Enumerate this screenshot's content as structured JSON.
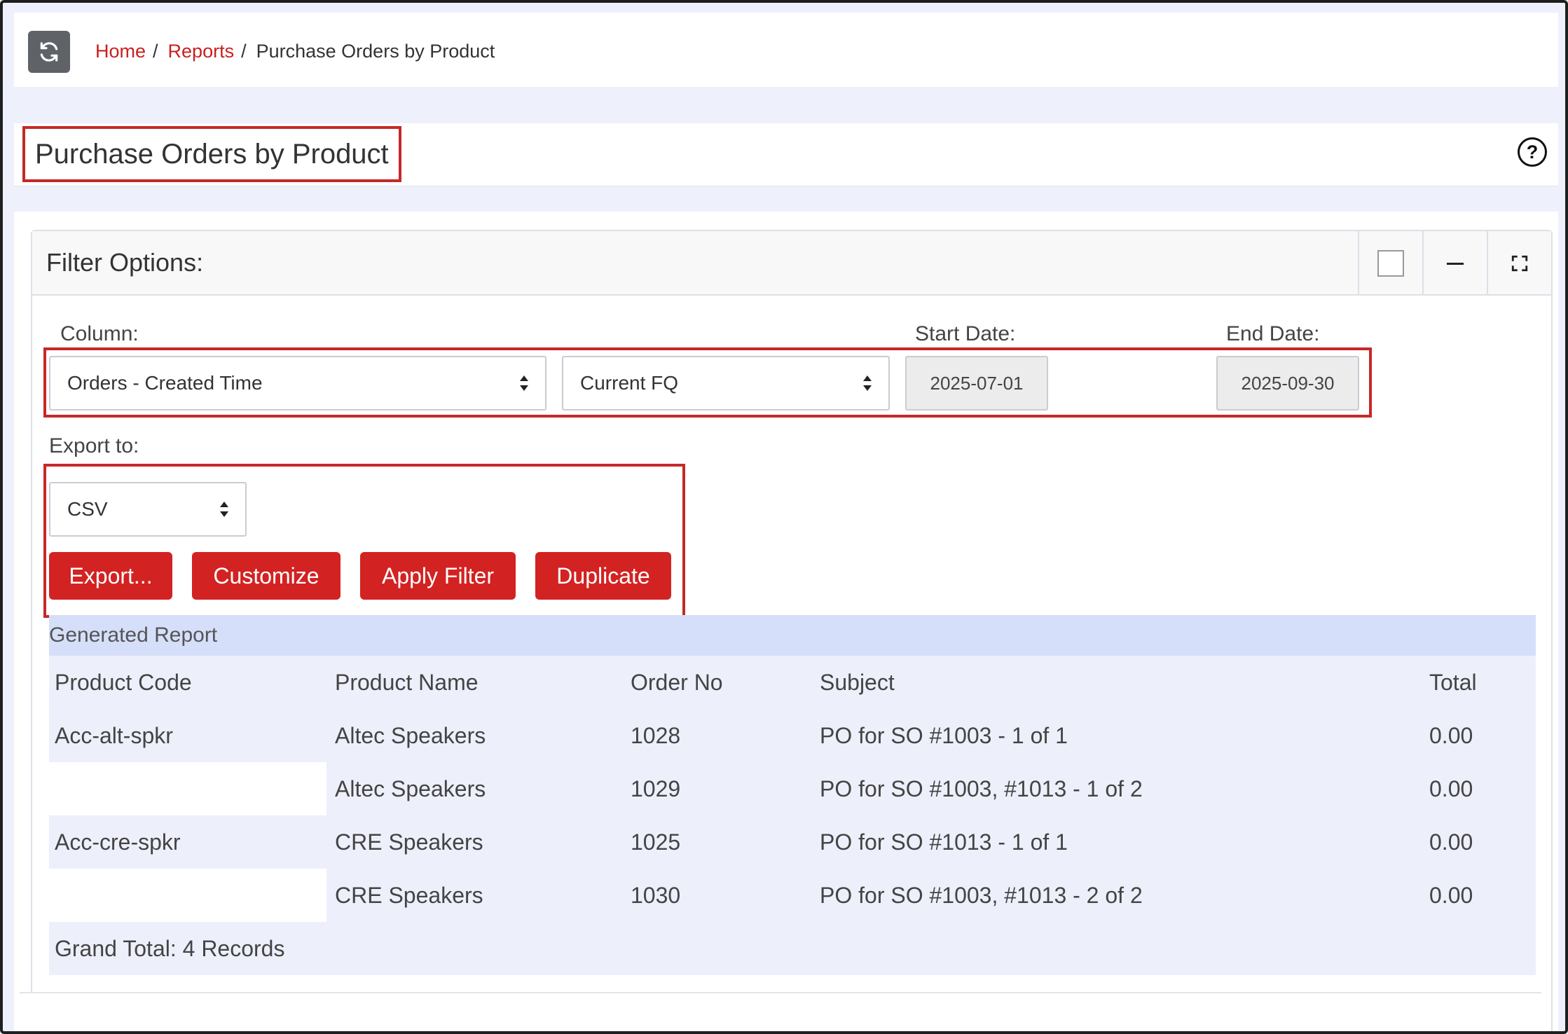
{
  "breadcrumb": {
    "home": "Home",
    "reports": "Reports",
    "current": "Purchase Orders by Product",
    "separator": "/"
  },
  "page": {
    "title": "Purchase Orders by Product",
    "help_symbol": "?"
  },
  "filter_panel": {
    "title": "Filter Options:",
    "column_label": "Column:",
    "column_value": "Orders - Created Time",
    "period_value": "Current FQ",
    "start_date_label": "Start Date:",
    "start_date": "2025-07-01",
    "end_date_label": "End Date:",
    "end_date": "2025-09-30",
    "export_label": "Export to:",
    "export_value": "CSV",
    "buttons": {
      "export": "Export...",
      "customize": "Customize",
      "apply": "Apply Filter",
      "duplicate": "Duplicate"
    }
  },
  "report": {
    "title": "Generated Report",
    "columns": [
      "Product Code",
      "Product Name",
      "Order No",
      "Subject",
      "Total"
    ],
    "rows": [
      {
        "code": "Acc-alt-spkr",
        "name": "Altec Speakers",
        "order_no": "1028",
        "subject": "PO for SO #1003 - 1 of 1",
        "total": "0.00"
      },
      {
        "code": "",
        "name": "Altec Speakers",
        "order_no": "1029",
        "subject": "PO for SO #1003, #1013 - 1 of 2",
        "total": "0.00"
      },
      {
        "code": "Acc-cre-spkr",
        "name": "CRE Speakers",
        "order_no": "1025",
        "subject": "PO for SO #1013 - 1 of 1",
        "total": "0.00"
      },
      {
        "code": "",
        "name": "CRE Speakers",
        "order_no": "1030",
        "subject": "PO for SO #1003, #1013 - 2 of 2",
        "total": "0.00"
      }
    ],
    "grand_total": "Grand Total: 4 Records"
  },
  "colors": {
    "accent_red": "#d32222",
    "link_red": "#c9201f",
    "highlight_box": "#c62828",
    "report_header_bg": "#d6dffa",
    "report_body_bg": "#edf0fb"
  },
  "icons": {
    "refresh": "refresh-icon",
    "help": "help-icon",
    "minimize": "minus-icon",
    "maximize": "expand-icon",
    "select_arrows": "sort-arrows-icon"
  }
}
